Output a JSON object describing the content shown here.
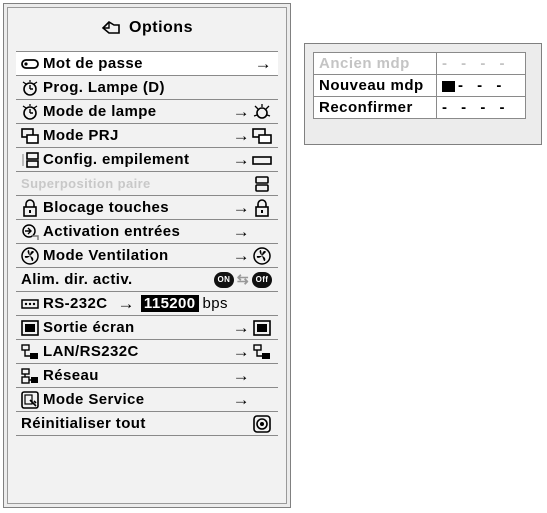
{
  "options": {
    "title": "Options",
    "items": [
      {
        "label": "Mot de passe",
        "icon": "key-icon",
        "arrow": "→",
        "state": "selected"
      },
      {
        "label": "Prog. Lampe (D)",
        "icon": "lamp-timer-icon",
        "arrow": "",
        "state": "normal"
      },
      {
        "label": "Mode de lampe",
        "icon": "lamp-timer-icon",
        "arrow": "→",
        "right_icon": "lamp-mode-icon",
        "state": "normal"
      },
      {
        "label": "Mode PRJ",
        "icon": "projection-mode-icon",
        "arrow": "→",
        "right_icon": "projection-mode-icon",
        "state": "normal"
      },
      {
        "label": "Config. empilement",
        "icon": "stack-setup-icon",
        "arrow": "→",
        "right_icon": "stack-rect-icon",
        "state": "normal"
      },
      {
        "label": "Superposition paire",
        "icon": "",
        "arrow": "",
        "right_icon": "stack-pair-icon",
        "state": "disabled"
      },
      {
        "label": "Blocage touches",
        "icon": "padlock-icon",
        "arrow": "→",
        "right_icon": "padlock-icon",
        "state": "normal"
      },
      {
        "label": "Activation entrées",
        "icon": "input-activation-icon",
        "arrow": "→",
        "state": "normal"
      },
      {
        "label": "Mode Ventilation",
        "icon": "fan-icon",
        "arrow": "→",
        "right_icon": "fan-icon",
        "state": "normal"
      },
      {
        "label": "Alim. dir. activ.",
        "icon": "",
        "state": "normal",
        "toggle": {
          "on": "ON",
          "off": "Off"
        }
      },
      {
        "label": "RS-232C",
        "icon": "rs232c-port-icon",
        "arrow": "→",
        "baud": "115200",
        "unit": "bps",
        "state": "normal"
      },
      {
        "label": "Sortie écran",
        "icon": "monitor-out-icon",
        "arrow": "→",
        "right_icon": "monitor-out-icon",
        "state": "normal"
      },
      {
        "label": "LAN/RS232C",
        "icon": "lan-rs232c-icon",
        "arrow": "→",
        "right_icon": "lan-rs232c-icon",
        "state": "normal"
      },
      {
        "label": "Réseau",
        "icon": "network-icon",
        "arrow": "→",
        "state": "normal"
      },
      {
        "label": "Mode Service",
        "icon": "service-mode-icon",
        "arrow": "→",
        "state": "normal"
      },
      {
        "label": "Réinitialiser tout",
        "icon": "",
        "right_icon": "reset-icon",
        "state": "normal"
      }
    ]
  },
  "password": {
    "rows": [
      {
        "label": "Ancien mdp",
        "value": "- - - -",
        "state": "disabled"
      },
      {
        "label": "Nouveau mdp",
        "value": "- - -",
        "cursor": true,
        "state": "active"
      },
      {
        "label": "Reconfirmer",
        "value": "- - - -",
        "state": "normal"
      }
    ]
  }
}
